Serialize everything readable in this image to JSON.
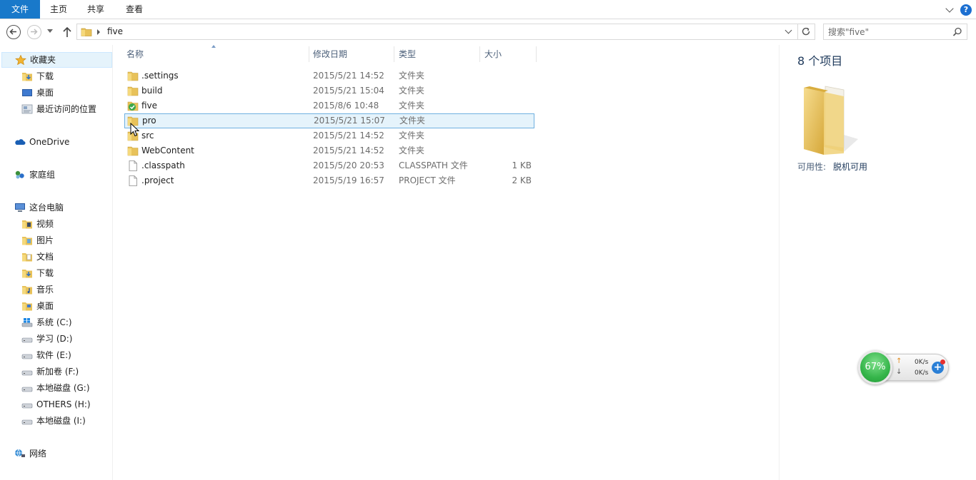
{
  "ribbon": {
    "tabs": [
      "文件",
      "主页",
      "共享",
      "查看"
    ]
  },
  "address": {
    "crumb": "five"
  },
  "search": {
    "placeholder": "搜索\"five\""
  },
  "navpane": {
    "favorites": "收藏夹",
    "fav_items": [
      "下载",
      "桌面",
      "最近访问的位置"
    ],
    "onedrive": "OneDrive",
    "homegroup": "家庭组",
    "thispc": "这台电脑",
    "pc_items": [
      "视频",
      "图片",
      "文档",
      "下载",
      "音乐",
      "桌面",
      "系统 (C:)",
      "学习 (D:)",
      "软件 (E:)",
      "新加卷 (F:)",
      "本地磁盘 (G:)",
      "OTHERS (H:)",
      "本地磁盘 (I:)"
    ],
    "network": "网络"
  },
  "columns": {
    "name": "名称",
    "date": "修改日期",
    "type": "类型",
    "size": "大小"
  },
  "files": [
    {
      "name": ".settings",
      "date": "2015/5/21 14:52",
      "type": "文件夹",
      "size": "",
      "icon": "folder-icon"
    },
    {
      "name": "build",
      "date": "2015/5/21 15:04",
      "type": "文件夹",
      "size": "",
      "icon": "folder-icon"
    },
    {
      "name": "five",
      "date": "2015/8/6 10:48",
      "type": "文件夹",
      "size": "",
      "icon": "folder-check-icon"
    },
    {
      "name": "pro",
      "date": "2015/5/21 15:07",
      "type": "文件夹",
      "size": "",
      "icon": "folder-icon"
    },
    {
      "name": "src",
      "date": "2015/5/21 14:52",
      "type": "文件夹",
      "size": "",
      "icon": "folder-icon"
    },
    {
      "name": "WebContent",
      "date": "2015/5/21 14:52",
      "type": "文件夹",
      "size": "",
      "icon": "folder-icon"
    },
    {
      "name": ".classpath",
      "date": "2015/5/20 20:53",
      "type": "CLASSPATH 文件",
      "size": "1 KB",
      "icon": "file-icon"
    },
    {
      "name": ".project",
      "date": "2015/5/19 16:57",
      "type": "PROJECT 文件",
      "size": "2 KB",
      "icon": "file-icon"
    }
  ],
  "preview": {
    "count": "8 个项目",
    "availability_label": "可用性:",
    "availability_value": "脱机可用"
  },
  "widget": {
    "percent": "67%",
    "up_speed": "0K/s",
    "down_speed": "0K/s"
  },
  "colors": {
    "file_tab": "#1979ca",
    "selection": "#e5f3fb",
    "accent_text": "#1e395b"
  }
}
